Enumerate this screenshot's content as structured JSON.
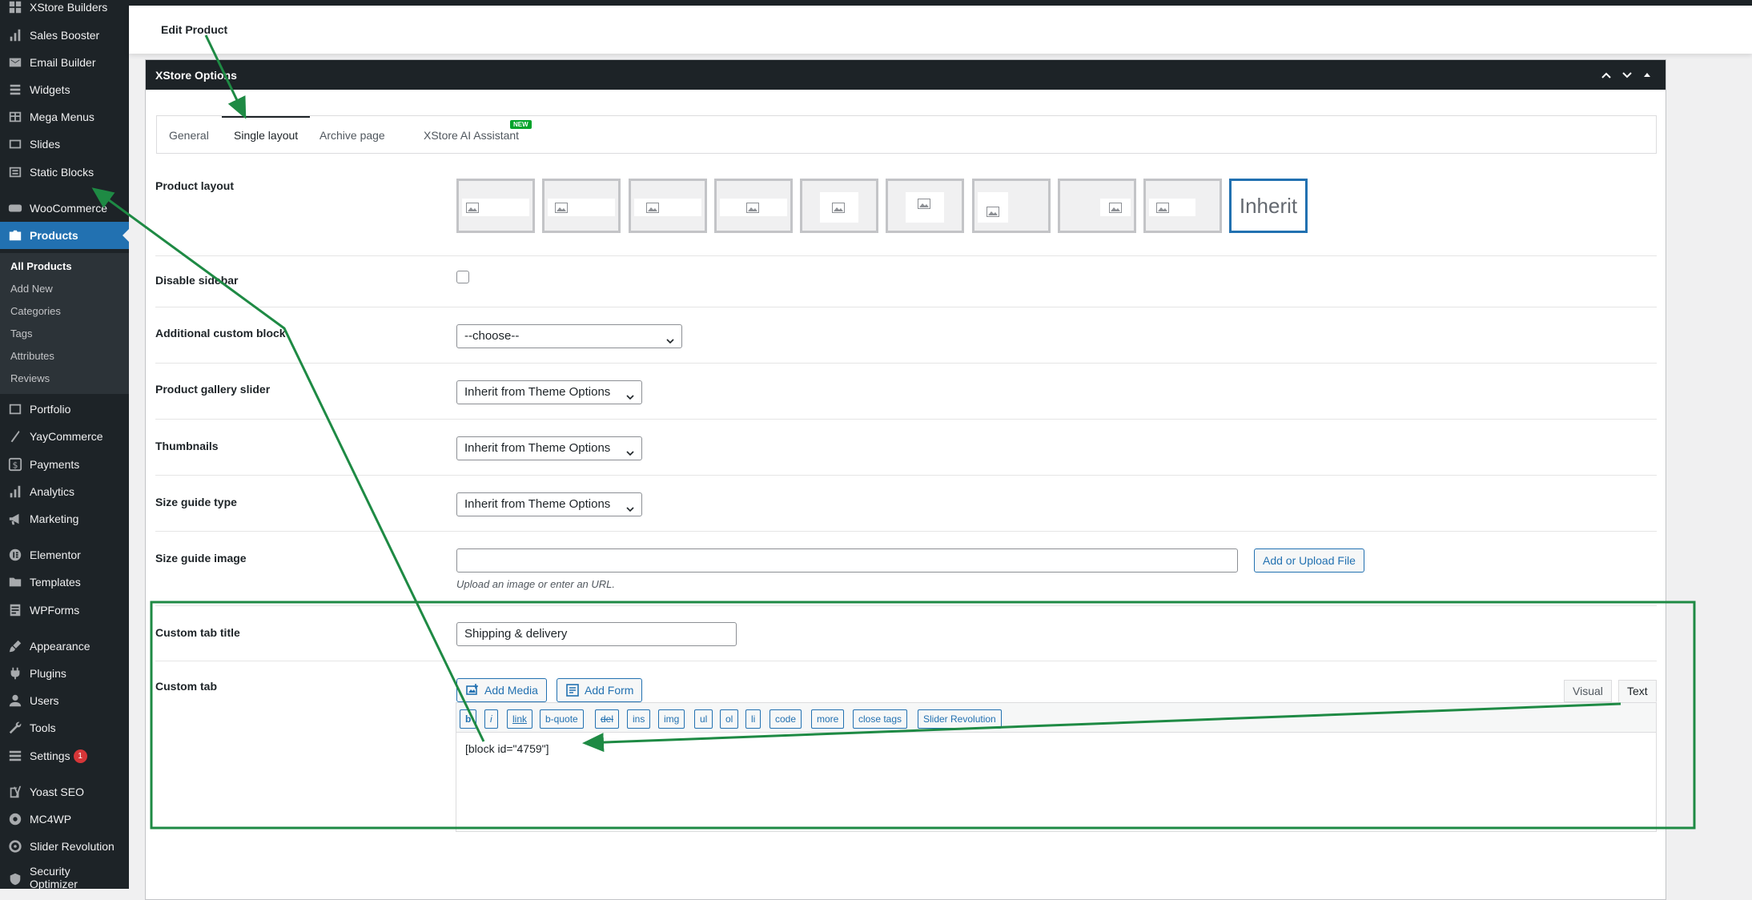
{
  "sidebar": {
    "items": [
      {
        "label": "XStore Builders",
        "icon": "grid-icon"
      },
      {
        "label": "Sales Booster",
        "icon": "bar-chart-icon"
      },
      {
        "label": "Email Builder",
        "icon": "envelope-icon"
      },
      {
        "label": "Widgets",
        "icon": "list-icon"
      },
      {
        "label": "Mega Menus",
        "icon": "table-icon"
      },
      {
        "label": "Slides",
        "icon": "slides-icon"
      },
      {
        "label": "Static Blocks",
        "icon": "blocks-icon"
      },
      {
        "label": "WooCommerce",
        "icon": "woo-icon"
      },
      {
        "label": "Products",
        "icon": "products-icon"
      },
      {
        "label": "Portfolio",
        "icon": "portfolio-icon"
      },
      {
        "label": "YayCommerce",
        "icon": "yay-icon"
      },
      {
        "label": "Payments",
        "icon": "dollar-icon"
      },
      {
        "label": "Analytics",
        "icon": "bar-chart-icon"
      },
      {
        "label": "Marketing",
        "icon": "megaphone-icon"
      },
      {
        "label": "Elementor",
        "icon": "elementor-icon"
      },
      {
        "label": "Templates",
        "icon": "folder-icon"
      },
      {
        "label": "WPForms",
        "icon": "form-icon"
      },
      {
        "label": "Appearance",
        "icon": "brush-icon"
      },
      {
        "label": "Plugins",
        "icon": "plug-icon"
      },
      {
        "label": "Users",
        "icon": "user-icon"
      },
      {
        "label": "Tools",
        "icon": "wrench-icon"
      },
      {
        "label": "Settings",
        "icon": "settings-icon",
        "badge": "1"
      },
      {
        "label": "Yoast SEO",
        "icon": "yoast-icon"
      },
      {
        "label": "MC4WP",
        "icon": "mc4wp-icon"
      },
      {
        "label": "Slider Revolution",
        "icon": "revolution-icon"
      },
      {
        "label": "Security Optimizer",
        "icon": "security-icon"
      }
    ],
    "submenu": [
      "All Products",
      "Add New",
      "Categories",
      "Tags",
      "Attributes",
      "Reviews"
    ]
  },
  "header": {
    "title": "Edit Product"
  },
  "metabox": {
    "title": "XStore Options",
    "tabs": [
      {
        "label": "General"
      },
      {
        "label": "Single layout"
      },
      {
        "label": "Archive page"
      },
      {
        "label": "XStore AI Assistant",
        "badge": "NEW"
      }
    ]
  },
  "fields": {
    "product_layout": {
      "label": "Product layout",
      "inherit_label": "Inherit"
    },
    "disable_sidebar": {
      "label": "Disable sidebar"
    },
    "additional_block": {
      "label": "Additional custom block",
      "value": "--choose--"
    },
    "gallery_slider": {
      "label": "Product gallery slider",
      "value": "Inherit from Theme Options"
    },
    "thumbnails": {
      "label": "Thumbnails",
      "value": "Inherit from Theme Options"
    },
    "size_guide_type": {
      "label": "Size guide type",
      "value": "Inherit from Theme Options"
    },
    "size_guide_image": {
      "label": "Size guide image",
      "button": "Add or Upload File",
      "hint": "Upload an image or enter an URL."
    },
    "custom_tab_title": {
      "label": "Custom tab title",
      "value": "Shipping & delivery"
    },
    "custom_tab": {
      "label": "Custom tab",
      "add_media": "Add Media",
      "add_form": "Add Form",
      "visual": "Visual",
      "text": "Text",
      "quicktags": [
        "b",
        "i",
        "link",
        "b-quote",
        "del",
        "ins",
        "img",
        "ul",
        "ol",
        "li",
        "code",
        "more",
        "close tags",
        "Slider Revolution"
      ],
      "content": "[block id=\"4759\"]"
    }
  },
  "colors": {
    "accent": "#2271b1",
    "annotation": "#1e8a44",
    "sidebar": "#1d2327"
  }
}
